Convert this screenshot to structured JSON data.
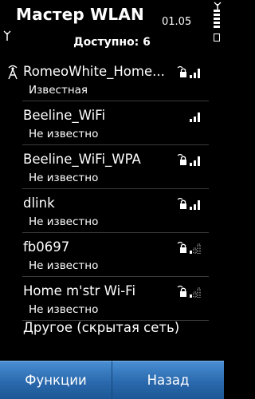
{
  "status_bar": {
    "app_title": "Мастер WLAN",
    "clock": "01.05",
    "left_icon": "antenna-icon",
    "right_icons": [
      "signal-strength-icon",
      "battery-icon"
    ]
  },
  "available_label": "Доступно: 6",
  "networks": [
    {
      "name": "RomeoWhite_Home...",
      "status": "Известная",
      "connected_icon": "wlan-antenna-icon",
      "secured": true,
      "signal": "strong"
    },
    {
      "name": "Beeline_WiFi",
      "status": "Не известно",
      "secured": false,
      "signal": "strong"
    },
    {
      "name": "Beeline_WiFi_WPA",
      "status": "Не известно",
      "secured": true,
      "signal": "strong"
    },
    {
      "name": "dlink",
      "status": "Не известно",
      "secured": true,
      "signal": "strong"
    },
    {
      "name": "fb0697",
      "status": "Не известно",
      "secured": true,
      "signal": "weak"
    },
    {
      "name": "Home m'str Wi-Fi",
      "status": "Не известно",
      "secured": true,
      "signal": "weak"
    }
  ],
  "other_network_label": "Другое (скрытая сеть)",
  "softkeys": {
    "left": "Функции",
    "right": "Назад"
  },
  "colors": {
    "background": "#000000",
    "softkey": "#2a69ad"
  }
}
